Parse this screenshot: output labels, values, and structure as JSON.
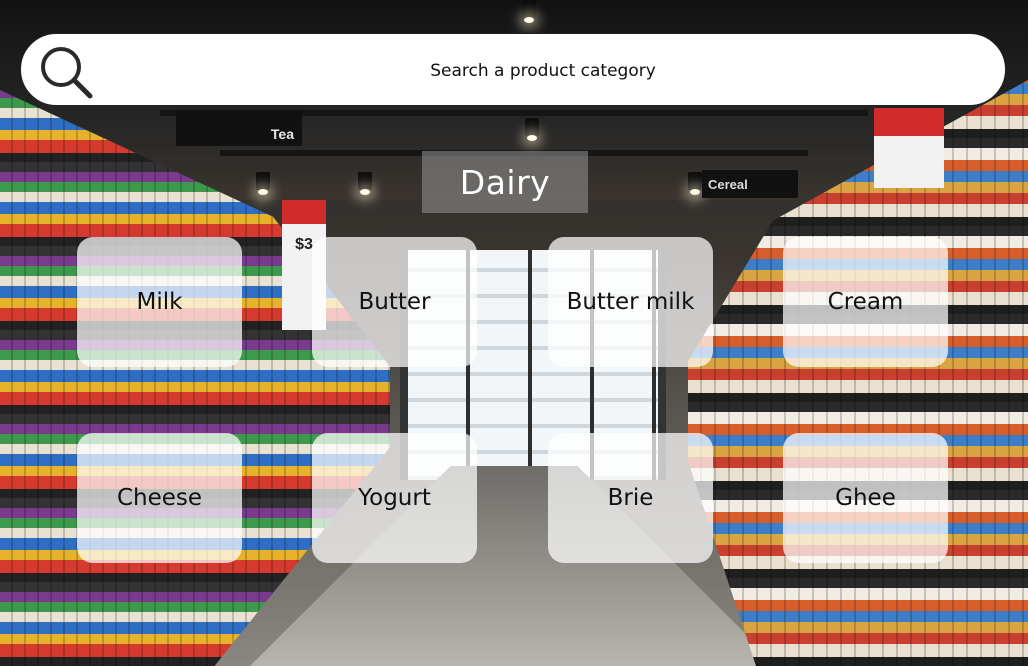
{
  "background": {
    "scene": "supermarket aisle",
    "signs": {
      "tea": "Tea",
      "cereal": "Cereal",
      "prices_left": "$3"
    }
  },
  "search": {
    "placeholder": "Search a product category",
    "value": "",
    "icon": "search-icon"
  },
  "category": {
    "title": "Dairy"
  },
  "products": [
    {
      "label": "Milk"
    },
    {
      "label": "Butter"
    },
    {
      "label": "Butter milk"
    },
    {
      "label": "Cream"
    },
    {
      "label": "Cheese"
    },
    {
      "label": "Yogurt"
    },
    {
      "label": "Brie"
    },
    {
      "label": "Ghee"
    }
  ],
  "colors": {
    "tile_background": "#ffffffb8",
    "title_background": "#96969680",
    "search_border": "#222222"
  }
}
